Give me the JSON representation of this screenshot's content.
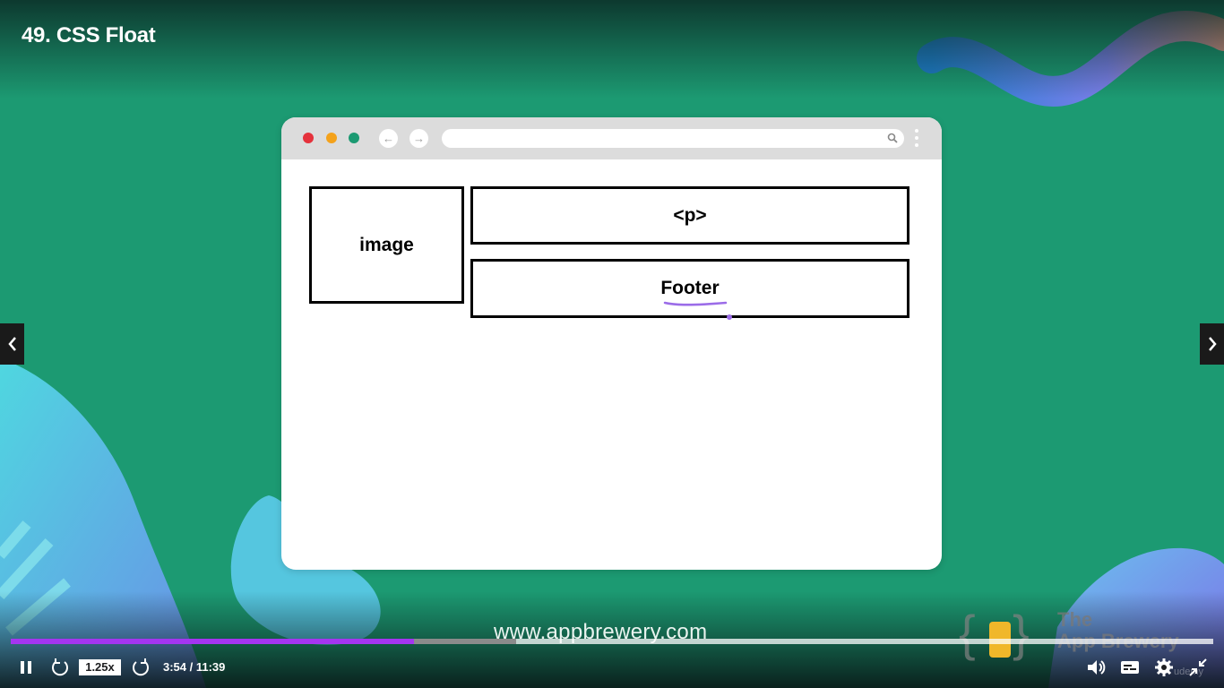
{
  "lecture": {
    "title": "49. CSS Float"
  },
  "slide": {
    "browser": {
      "boxes": {
        "image": "image",
        "p": "<p>",
        "footer": "Footer"
      }
    },
    "url_text": "www.appbrewery.com",
    "logo": {
      "line1": "The",
      "line2": "App Brewery"
    }
  },
  "nav": {
    "prev_icon": "chevron-left-icon",
    "next_icon": "chevron-right-icon"
  },
  "player": {
    "speed": "1.25x",
    "time": "3:54 / 11:39",
    "progress_fraction": 0.335,
    "buffered_fraction": 0.42,
    "accent": "#a435f0",
    "watermark": "udemy"
  },
  "colors": {
    "background": "#1c9a72",
    "red": "#e5323c",
    "yellow": "#f4a21b",
    "green": "#1c9a72"
  }
}
